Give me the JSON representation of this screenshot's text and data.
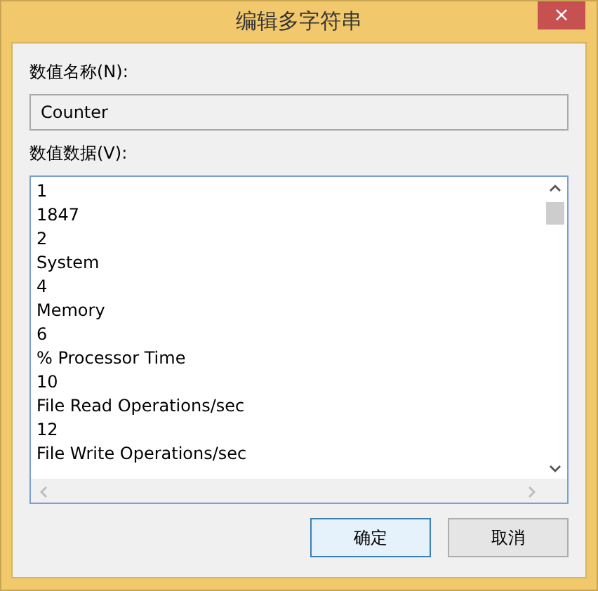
{
  "window": {
    "title": "编辑多字符串",
    "close": "×"
  },
  "name_field": {
    "label": "数值名称(N):",
    "value": "Counter"
  },
  "data_field": {
    "label": "数值数据(V):",
    "lines": [
      "1",
      "1847",
      "2",
      "System",
      "4",
      "Memory",
      "6",
      "% Processor Time",
      "10",
      "File Read Operations/sec",
      "12",
      "File Write Operations/sec"
    ]
  },
  "buttons": [
    {
      "label": "确定",
      "default": true
    },
    {
      "label": "取消",
      "default": false
    }
  ]
}
